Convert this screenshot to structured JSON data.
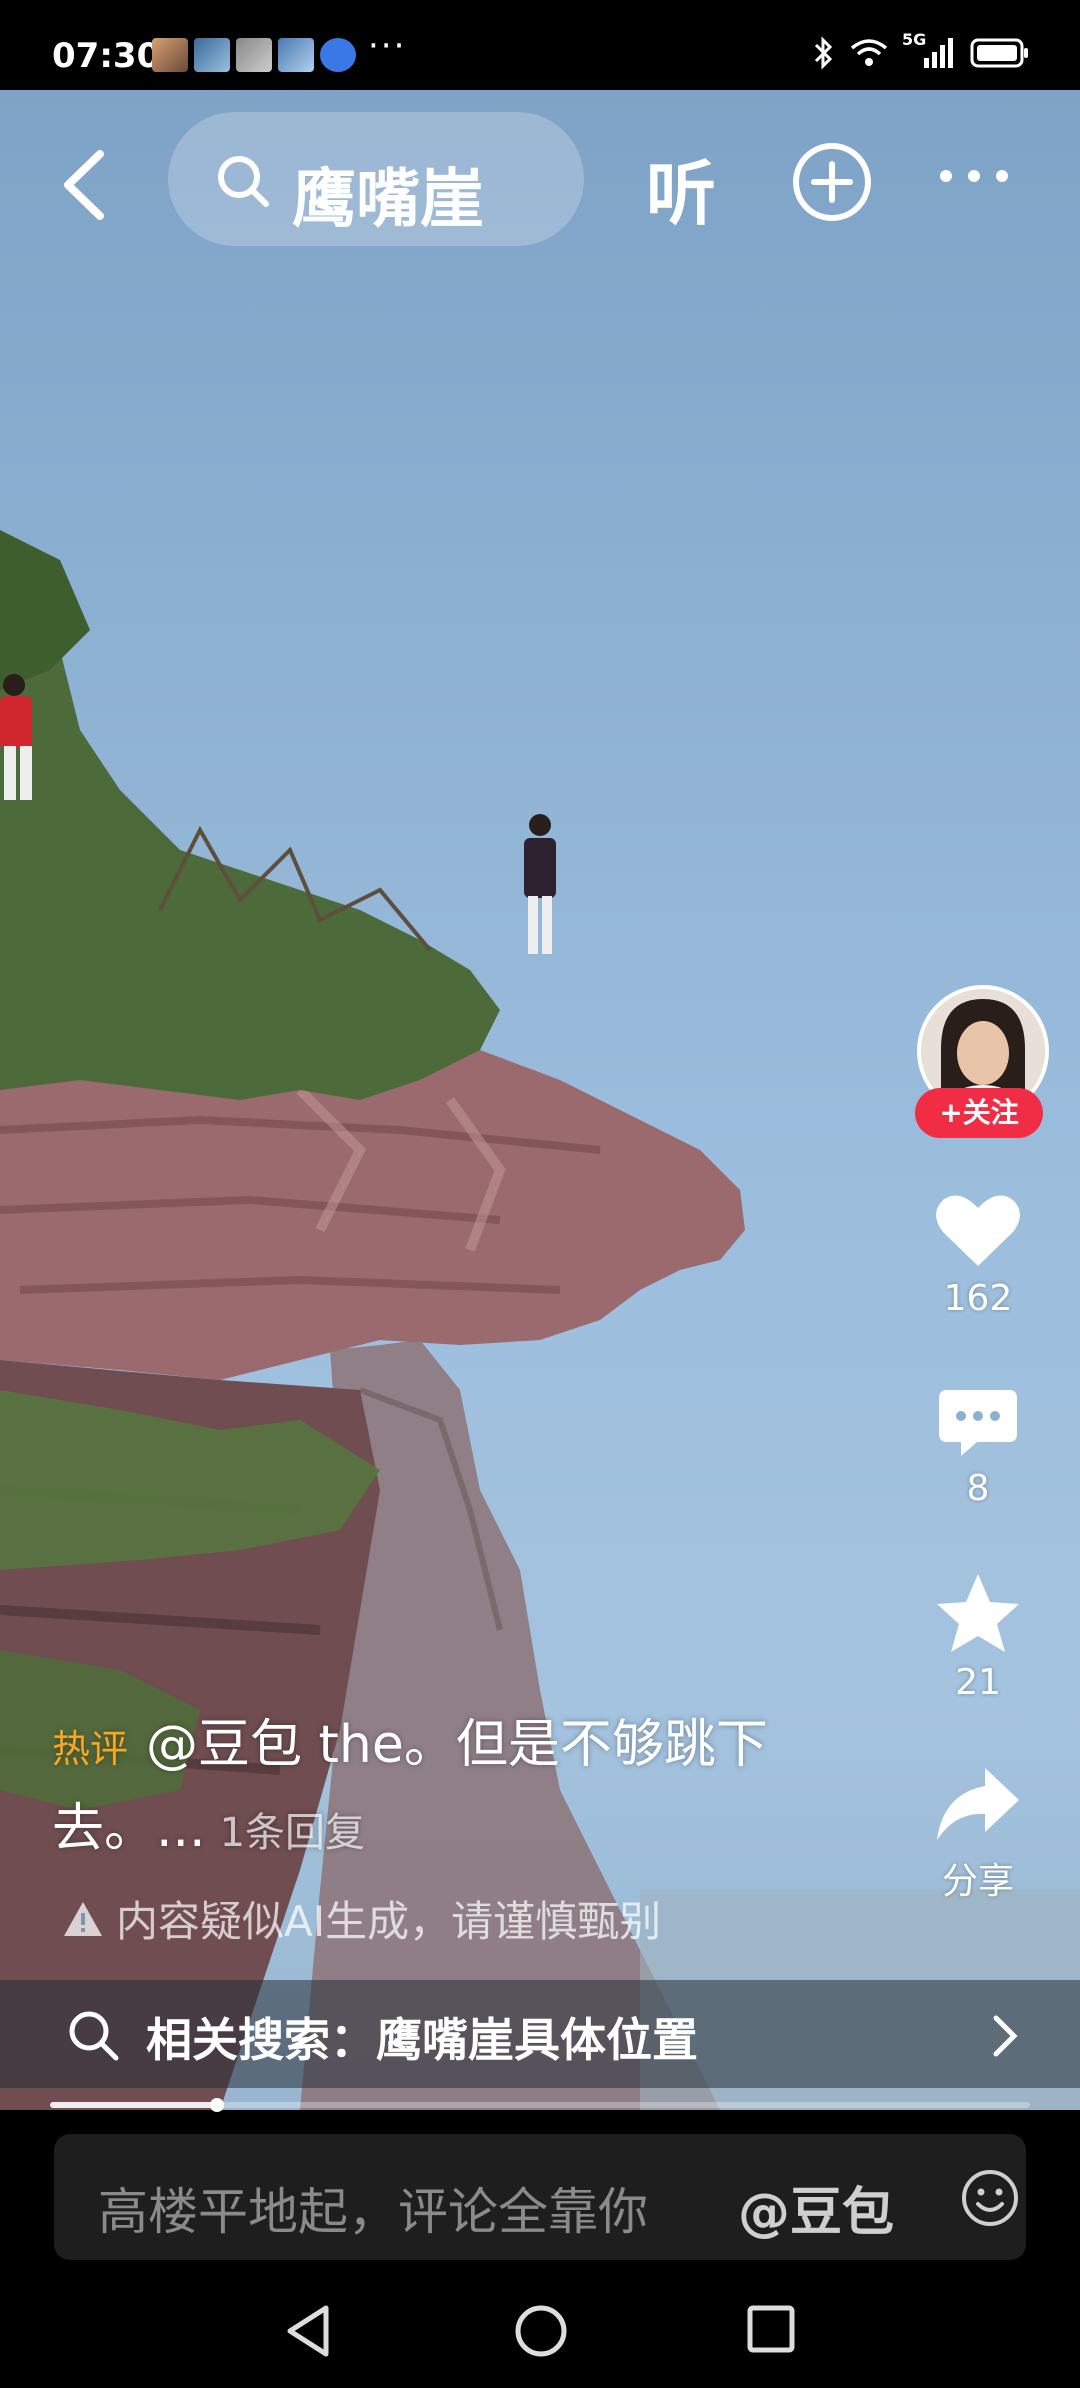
{
  "status_bar": {
    "time": "07:30",
    "more": "···",
    "signal": "5G"
  },
  "top_bar": {
    "search_query": "鹰嘴崖",
    "listen_label": "听"
  },
  "rail": {
    "follow_label": "+关注",
    "likes": "162",
    "comments": "8",
    "favorites": "21",
    "share_label": "分享"
  },
  "comment": {
    "tag": "热评",
    "text": "@豆包 the。但是不够跳下去。...",
    "replies": "1条回复"
  },
  "ai_notice": "内容疑似AI生成，请谨慎甄别",
  "related_search": "相关搜索：鹰嘴崖具体位置",
  "progress": 0.17,
  "comment_input": {
    "placeholder": "高楼平地起，评论全靠你",
    "mention": "@豆包"
  },
  "colors": {
    "follow_red": "#f02d45",
    "hot_tag": "#f5a623",
    "sky": "#8cb0d2"
  }
}
